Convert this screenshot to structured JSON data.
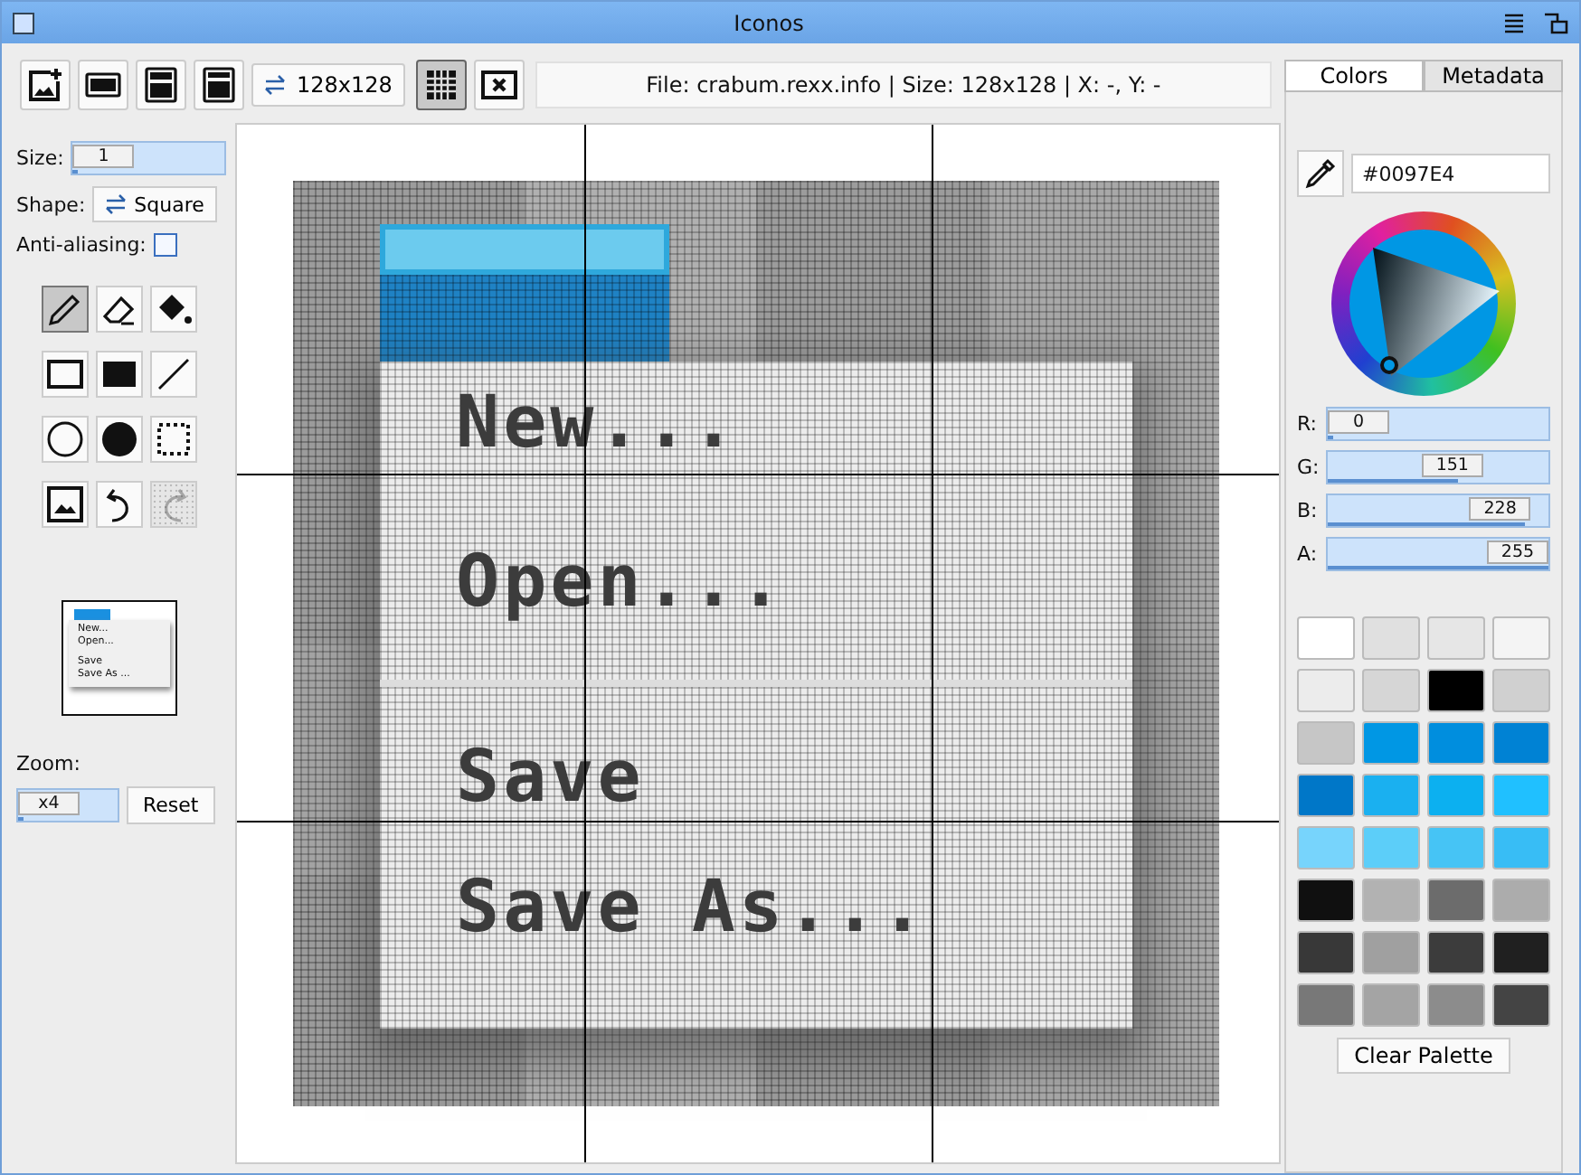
{
  "window": {
    "title": "Iconos"
  },
  "toolbar": {
    "buttons": [
      {
        "kind": "new-image",
        "selected": false
      },
      {
        "kind": "png",
        "selected": false
      },
      {
        "kind": "png-save",
        "selected": false
      },
      {
        "kind": "icon",
        "selected": false
      }
    ],
    "size_button": "128x128",
    "grid_button": {
      "selected": true
    },
    "status": "File: crabum.rexx.info | Size: 128x128 | X: -, Y: -"
  },
  "left_panel": {
    "size": {
      "label": "Size:",
      "value": "1",
      "level": 0
    },
    "shape": {
      "label": "Shape:",
      "value": "Square"
    },
    "antialiasing": {
      "label": "Anti-aliasing:",
      "checked": false
    },
    "tools": [
      {
        "kind": "pencil",
        "selected": true,
        "disabled": false
      },
      {
        "kind": "eraser",
        "selected": false,
        "disabled": false
      },
      {
        "kind": "fill",
        "selected": false,
        "disabled": false
      },
      {
        "kind": "rect",
        "selected": false,
        "disabled": false
      },
      {
        "kind": "rect-fill",
        "selected": false,
        "disabled": false
      },
      {
        "kind": "line",
        "selected": false,
        "disabled": false
      },
      {
        "kind": "circle",
        "selected": false,
        "disabled": false
      },
      {
        "kind": "circle-fill",
        "selected": false,
        "disabled": false
      },
      {
        "kind": "select",
        "selected": false,
        "disabled": false
      },
      {
        "kind": "image",
        "selected": false,
        "disabled": false
      },
      {
        "kind": "undo",
        "selected": false,
        "disabled": false
      },
      {
        "kind": "redo",
        "selected": false,
        "disabled": true
      }
    ],
    "preview_items": [
      "New...",
      "Open...",
      "Save",
      "Save As ..."
    ],
    "zoom": {
      "label": "Zoom:",
      "value": "x4",
      "level": 0,
      "reset": "Reset"
    }
  },
  "canvas": {
    "menu_items": [
      "New...",
      "Open...",
      "Save",
      "Save As..."
    ]
  },
  "right_panel": {
    "tabs": [
      {
        "label": "Colors",
        "selected": true
      },
      {
        "label": "Metadata",
        "selected": false
      }
    ],
    "hex": "#0097E4",
    "channels": [
      {
        "label": "R:",
        "value": "0",
        "level": 0
      },
      {
        "label": "G:",
        "value": "151",
        "level": 0.59
      },
      {
        "label": "B:",
        "value": "228",
        "level": 0.89
      },
      {
        "label": "A:",
        "value": "255",
        "level": 1
      }
    ],
    "palette": [
      {
        "color": "#ffffff"
      },
      {
        "color": "#e0e0e0"
      },
      {
        "color": "#e6e6e6"
      },
      {
        "color": "#f4f4f4"
      },
      {
        "color": "#ececec"
      },
      {
        "color": "#d6d6d6"
      },
      {
        "color": "#000000"
      },
      {
        "color": "#d0d0d0"
      },
      {
        "color": "#c6c6c6"
      },
      {
        "color": "#0097e4"
      },
      {
        "color": "#008ede"
      },
      {
        "color": "#0082d4"
      },
      {
        "color": "#0077c8"
      },
      {
        "color": "#1ab0f0"
      },
      {
        "color": "#0cb0f0"
      },
      {
        "color": "#20c0ff"
      },
      {
        "color": "#77d4fc"
      },
      {
        "color": "#5ccef9"
      },
      {
        "color": "#46c4f5"
      },
      {
        "color": "#38bdf5"
      },
      {
        "color": "#101010"
      },
      {
        "color": "#b2b2b2"
      },
      {
        "color": "#6c6c6c"
      },
      {
        "color": "#acacac"
      },
      {
        "color": "#383838"
      },
      {
        "color": "#a0a0a0"
      },
      {
        "color": "#3c3c3c"
      },
      {
        "color": "#202020"
      },
      {
        "color": "#787878"
      },
      {
        "color": "#a4a4a4"
      },
      {
        "color": "#8c8c8c"
      },
      {
        "color": "#444444"
      }
    ],
    "clear_button": "Clear Palette"
  }
}
